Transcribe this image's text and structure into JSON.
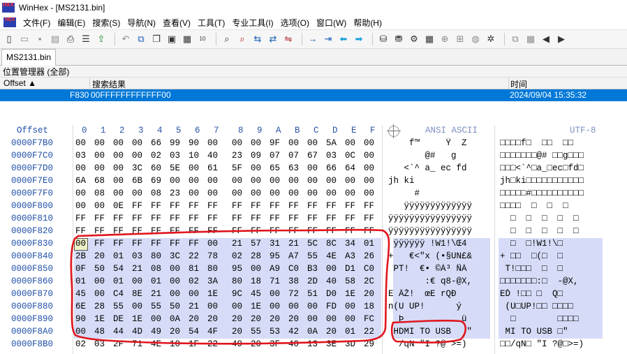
{
  "window": {
    "title": "WinHex - [MS2131.bin]",
    "logo": "HEX"
  },
  "menu": {
    "items": [
      "文件(F)",
      "编辑(E)",
      "搜索(S)",
      "导航(N)",
      "查看(V)",
      "工具(T)",
      "专业工具(I)",
      "选项(O)",
      "窗口(W)",
      "帮助(H)"
    ]
  },
  "toolbar": {
    "icons": [
      "new-file-icon",
      "open-file-icon",
      "save-icon",
      "save-all-icon",
      "print-icon",
      "properties-icon",
      "export-icon",
      "undo-icon",
      "copy-icon",
      "copy-block-icon",
      "paste-icon",
      "paste-write-icon",
      "binary-icon",
      "find-text-icon",
      "find-hex-icon",
      "replace-text-icon",
      "replace-hex-icon",
      "goto-offset-icon",
      "goto-end-icon",
      "back-icon",
      "forward-icon",
      "open-disk-icon",
      "open-ram-icon",
      "disk-tools-icon",
      "calculator-icon",
      "zoom-icon",
      "hash-icon",
      "web-icon",
      "settings-icon",
      "window-icon",
      "info-icon",
      "nav-left-icon",
      "nav-right-icon"
    ]
  },
  "tab": {
    "file_name": "MS2131.bin"
  },
  "position_manager": {
    "title": "位置管理器 (全部)",
    "col_offset": "Offset",
    "col_search": "搜索结果",
    "col_time": "时间",
    "row": {
      "offset": "F830",
      "result": "00FFFFFFFFFFFF00",
      "time": "2024/09/04  15:35:32"
    }
  },
  "hex_view": {
    "header_offset": "Offset",
    "columns": [
      "0",
      "1",
      "2",
      "3",
      "4",
      "5",
      "6",
      "7",
      "8",
      "9",
      "A",
      "B",
      "C",
      "D",
      "E",
      "F"
    ],
    "header_ansi": "ANSI ASCII",
    "header_utf8": "UTF-8",
    "rows": [
      {
        "offset": "0000F7B0",
        "bytes": [
          "00",
          "00",
          "00",
          "00",
          "66",
          "99",
          "90",
          "00",
          "00",
          "00",
          "9F",
          "00",
          "00",
          "5A",
          "00",
          "00"
        ],
        "ansi": "    f™     Ÿ  Z  ",
        "utf8": "□□□□f□  □□  □□"
      },
      {
        "offset": "0000F7C0",
        "bytes": [
          "03",
          "00",
          "00",
          "00",
          "02",
          "03",
          "10",
          "40",
          "23",
          "09",
          "07",
          "07",
          "67",
          "03",
          "0C",
          "00"
        ],
        "ansi": "       @#   g    ",
        "utf8": "□□□□□□□@# □□g□□□"
      },
      {
        "offset": "0000F7D0",
        "bytes": [
          "00",
          "00",
          "00",
          "3C",
          "60",
          "5E",
          "00",
          "61",
          "5F",
          "00",
          "65",
          "63",
          "00",
          "66",
          "64",
          "00"
        ],
        "ansi": "   <`^ a_ ec fd ",
        "utf8": "□□□<`^□a_□ec□fd□"
      },
      {
        "offset": "0000F7E0",
        "bytes": [
          "6A",
          "68",
          "00",
          "6B",
          "69",
          "00",
          "00",
          "00",
          "00",
          "00",
          "00",
          "00",
          "00",
          "00",
          "00",
          "00"
        ],
        "ansi": "jh ki           ",
        "utf8": "jh□ki□□□□□□□□□□□"
      },
      {
        "offset": "0000F7F0",
        "bytes": [
          "00",
          "08",
          "00",
          "00",
          "08",
          "23",
          "00",
          "00",
          "00",
          "00",
          "00",
          "00",
          "00",
          "00",
          "00",
          "00"
        ],
        "ansi": "     #          ",
        "utf8": "□□□□□#□□□□□□□□□□"
      },
      {
        "offset": "0000F800",
        "bytes": [
          "00",
          "00",
          "0E",
          "FF",
          "FF",
          "FF",
          "FF",
          "FF",
          "FF",
          "FF",
          "FF",
          "FF",
          "FF",
          "FF",
          "FF",
          "FF"
        ],
        "ansi": "   ÿÿÿÿÿÿÿÿÿÿÿÿÿ",
        "utf8": "□□□□  □  □  □"
      },
      {
        "offset": "0000F810",
        "bytes": [
          "FF",
          "FF",
          "FF",
          "FF",
          "FF",
          "FF",
          "FF",
          "FF",
          "FF",
          "FF",
          "FF",
          "FF",
          "FF",
          "FF",
          "FF",
          "FF"
        ],
        "ansi": "ÿÿÿÿÿÿÿÿÿÿÿÿÿÿÿÿ",
        "utf8": "  □  □  □  □  □"
      },
      {
        "offset": "0000F820",
        "bytes": [
          "FF",
          "FF",
          "FF",
          "FF",
          "FF",
          "FF",
          "FF",
          "FF",
          "FF",
          "FF",
          "FF",
          "FF",
          "FF",
          "FF",
          "FF",
          "FF"
        ],
        "ansi": "ÿÿÿÿÿÿÿÿÿÿÿÿÿÿÿÿ",
        "utf8": "  □  □  □  □  □"
      },
      {
        "offset": "0000F830",
        "bytes": [
          "00",
          "FF",
          "FF",
          "FF",
          "FF",
          "FF",
          "FF",
          "00",
          "21",
          "57",
          "31",
          "21",
          "5C",
          "8C",
          "34",
          "01"
        ],
        "ansi": " ÿÿÿÿÿÿ !W1!\\Œ4 ",
        "utf8": "  □  □!W1!\\□"
      },
      {
        "offset": "0000F840",
        "bytes": [
          "2B",
          "20",
          "01",
          "03",
          "80",
          "3C",
          "22",
          "78",
          "02",
          "28",
          "95",
          "A7",
          "55",
          "4E",
          "A3",
          "26"
        ],
        "ansi": "+   €<\"x (•§UN£&",
        "utf8": "+ □□  □(□  □"
      },
      {
        "offset": "0000F850",
        "bytes": [
          "0F",
          "50",
          "54",
          "21",
          "08",
          "00",
          "81",
          "80",
          "95",
          "00",
          "A9",
          "C0",
          "B3",
          "00",
          "D1",
          "C0"
        ],
        "ansi": " PT!  €• ©À³ ÑÀ",
        "utf8": " T!□□□  □  □"
      },
      {
        "offset": "0000F860",
        "bytes": [
          "01",
          "00",
          "01",
          "00",
          "01",
          "00",
          "02",
          "3A",
          "80",
          "18",
          "71",
          "38",
          "2D",
          "40",
          "58",
          "2C"
        ],
        "ansi": "       :€ q8-@X,",
        "utf8": "□□□□□□□:□  -@X,"
      },
      {
        "offset": "0000F870",
        "bytes": [
          "45",
          "00",
          "C4",
          "8E",
          "21",
          "00",
          "00",
          "1E",
          "9C",
          "45",
          "00",
          "72",
          "51",
          "D0",
          "1E",
          "20"
        ],
        "ansi": "E ÄŽ!  œE rQÐ  ",
        "utf8": "EĎ !□□ □  Q□"
      },
      {
        "offset": "0000F880",
        "bytes": [
          "6E",
          "28",
          "55",
          "00",
          "55",
          "50",
          "21",
          "00",
          "00",
          "1E",
          "00",
          "00",
          "00",
          "FD",
          "00",
          "18"
        ],
        "ansi": "n(U UP!      ý  ",
        "utf8": " (U□UP!□□ □□□□"
      },
      {
        "offset": "0000F890",
        "bytes": [
          "90",
          "1E",
          "DE",
          "1E",
          "00",
          "0A",
          "20",
          "20",
          "20",
          "20",
          "20",
          "20",
          "00",
          "00",
          "00",
          "FC"
        ],
        "ansi": "  Þ           ü",
        "utf8": "  □        □□□□"
      },
      {
        "offset": "0000F8A0",
        "bytes": [
          "00",
          "48",
          "44",
          "4D",
          "49",
          "20",
          "54",
          "4F",
          "20",
          "55",
          "53",
          "42",
          "0A",
          "20",
          "01",
          "22"
        ],
        "ansi": " HDMI TO USB   \"",
        "utf8": " MI TO USB □\""
      },
      {
        "offset": "0000F8B0",
        "bytes": [
          "02",
          "03",
          "2F",
          "71",
          "4E",
          "10",
          "1F",
          "22",
          "49",
          "20",
          "3F",
          "40",
          "13",
          "3E",
          "3D",
          "29"
        ],
        "ansi": "  /qN \"I ?@ >=)",
        "utf8": "□□/qN□ \"I ?@□>=)"
      }
    ]
  },
  "colors": {
    "selection": "#d6dcf7",
    "offset_blue": "#1f4fa8",
    "pm_highlight": "#0078d7",
    "annotation": "#e0161e"
  }
}
